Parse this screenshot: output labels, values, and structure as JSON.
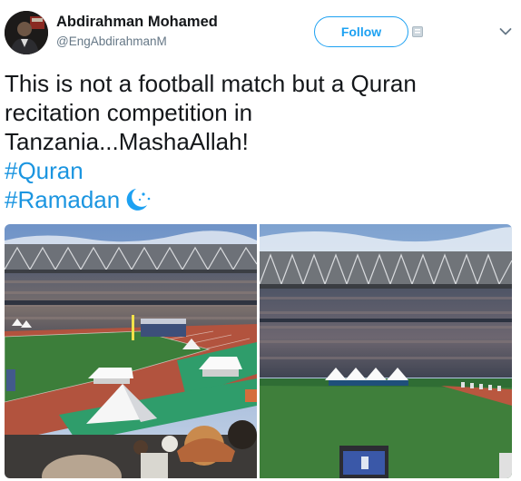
{
  "author": {
    "display_name": "Abdirahman Mohamed",
    "username": "@EngAbdirahmanM"
  },
  "actions": {
    "follow_label": "Follow"
  },
  "tweet": {
    "lines": [
      "This is not a football match but a Quran",
      "recitation competition in",
      "Tanzania...MashaAllah!"
    ],
    "hashtags": [
      "#Quran",
      "#Ramadan"
    ],
    "emoji": "crescent-moon-stars-icon"
  },
  "media": {
    "count": 2,
    "items": [
      {
        "name": "stadium-photo-left"
      },
      {
        "name": "stadium-photo-right"
      }
    ]
  },
  "colors": {
    "link": "#1b95e0",
    "follow_border": "#1da1f2",
    "secondary_text": "#657786"
  }
}
